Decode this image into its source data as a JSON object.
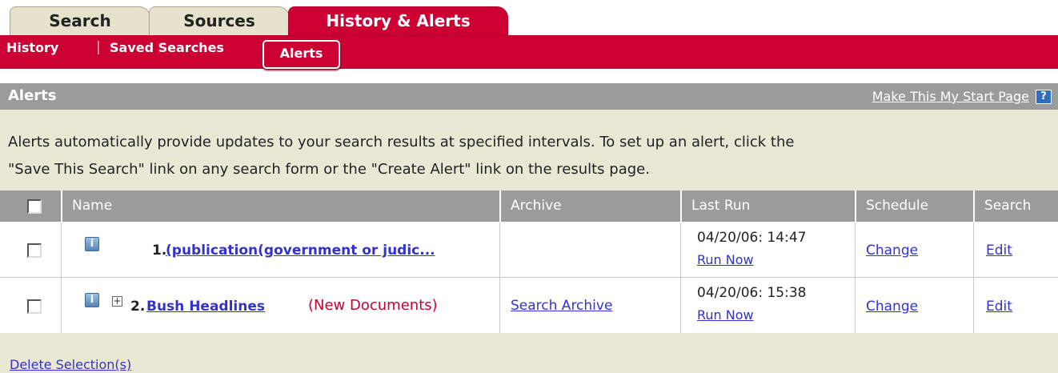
{
  "tabs": {
    "search": "Search",
    "sources": "Sources",
    "history_alerts": "History & Alerts"
  },
  "subnav": {
    "history": "History",
    "saved_searches": "Saved Searches",
    "alerts": "Alerts",
    "separator": "|"
  },
  "section": {
    "title": "Alerts",
    "start_page_link": "Make This My Start Page",
    "help_icon": "?"
  },
  "description": {
    "line1": "Alerts automatically provide updates to your search results at specified intervals. To set up an alert, click the",
    "line2": "\"Save This Search\" link on any search form or the \"Create Alert\" link on the results page."
  },
  "table": {
    "columns": [
      "Name",
      "Archive",
      "Last Run",
      "Schedule",
      "Search"
    ],
    "rows": [
      {
        "number": "1.",
        "name": "(publication(government or judic...",
        "new_documents": "",
        "archive": "",
        "last_run": "04/20/06: 14:47",
        "run_now": "Run Now",
        "schedule": "Change",
        "search": "Edit"
      },
      {
        "number": "2.",
        "name": "Bush Headlines",
        "new_documents": "(New Documents)",
        "archive": "Search Archive",
        "last_run": "04/20/06: 15:38",
        "run_now": "Run Now",
        "schedule": "Change",
        "search": "Edit"
      }
    ]
  },
  "footer": {
    "delete_link": "Delete Selection(s)"
  },
  "icons": {
    "info": "info-icon",
    "expand": "plus-box-icon",
    "help": "help-icon"
  },
  "colors": {
    "brand_red": "#cc0033",
    "tab_beige": "#e6e2cb",
    "header_gray": "#9b9b9b",
    "panel_beige": "#eae7d4",
    "link_blue": "#3333cc"
  }
}
